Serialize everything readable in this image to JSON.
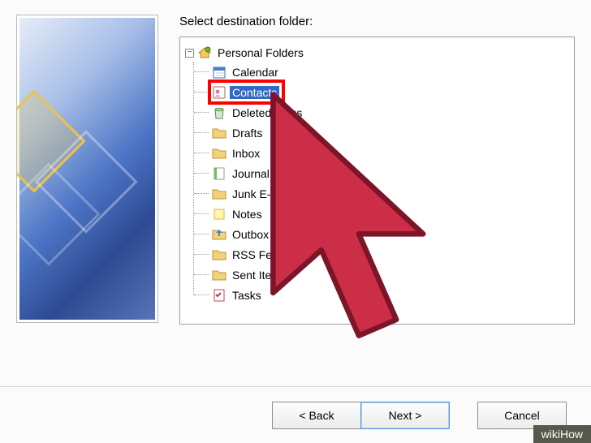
{
  "label": "Select destination folder:",
  "root": {
    "label": "Personal Folders"
  },
  "items": [
    {
      "label": "Calendar",
      "icon": "calendar"
    },
    {
      "label": "Contacts",
      "icon": "contacts",
      "selected": true
    },
    {
      "label": "Deleted Items",
      "icon": "trash"
    },
    {
      "label": "Drafts",
      "icon": "folder"
    },
    {
      "label": "Inbox",
      "icon": "folder"
    },
    {
      "label": "Journal",
      "icon": "journal"
    },
    {
      "label": "Junk E-mail",
      "icon": "folder"
    },
    {
      "label": "Notes",
      "icon": "notes"
    },
    {
      "label": "Outbox",
      "icon": "outbox"
    },
    {
      "label": "RSS Feeds",
      "icon": "folder"
    },
    {
      "label": "Sent Items",
      "icon": "folder"
    },
    {
      "label": "Tasks",
      "icon": "tasks"
    }
  ],
  "buttons": {
    "back": "< Back",
    "next": "Next >",
    "cancel": "Cancel"
  },
  "highlight_item_index": 1,
  "watermark": "wikiHow"
}
